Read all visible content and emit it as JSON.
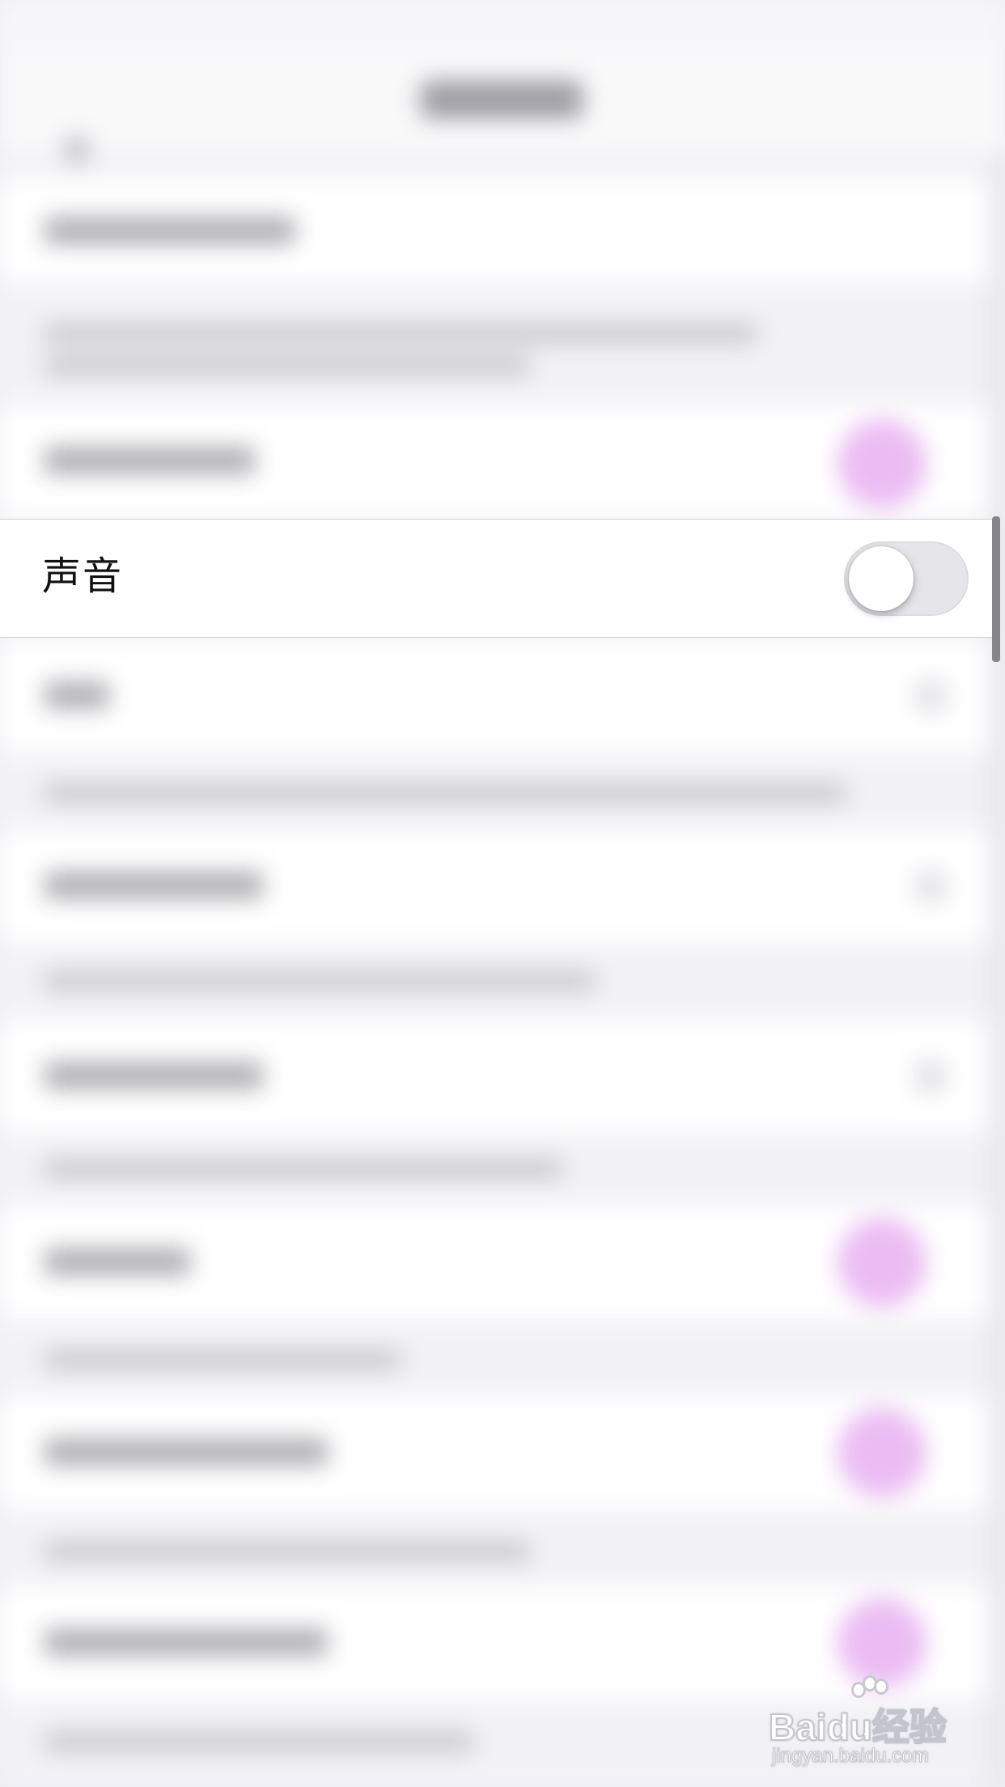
{
  "setting_row": {
    "label": "声音",
    "toggle_on": false
  },
  "colors": {
    "toggle_off_track": "#e6e6ea",
    "toggle_on_blurred": "#e4a6ef",
    "background": "#efeff4"
  },
  "watermark": {
    "brand": "Baidu经验",
    "url": "jingyan.baidu.com"
  }
}
